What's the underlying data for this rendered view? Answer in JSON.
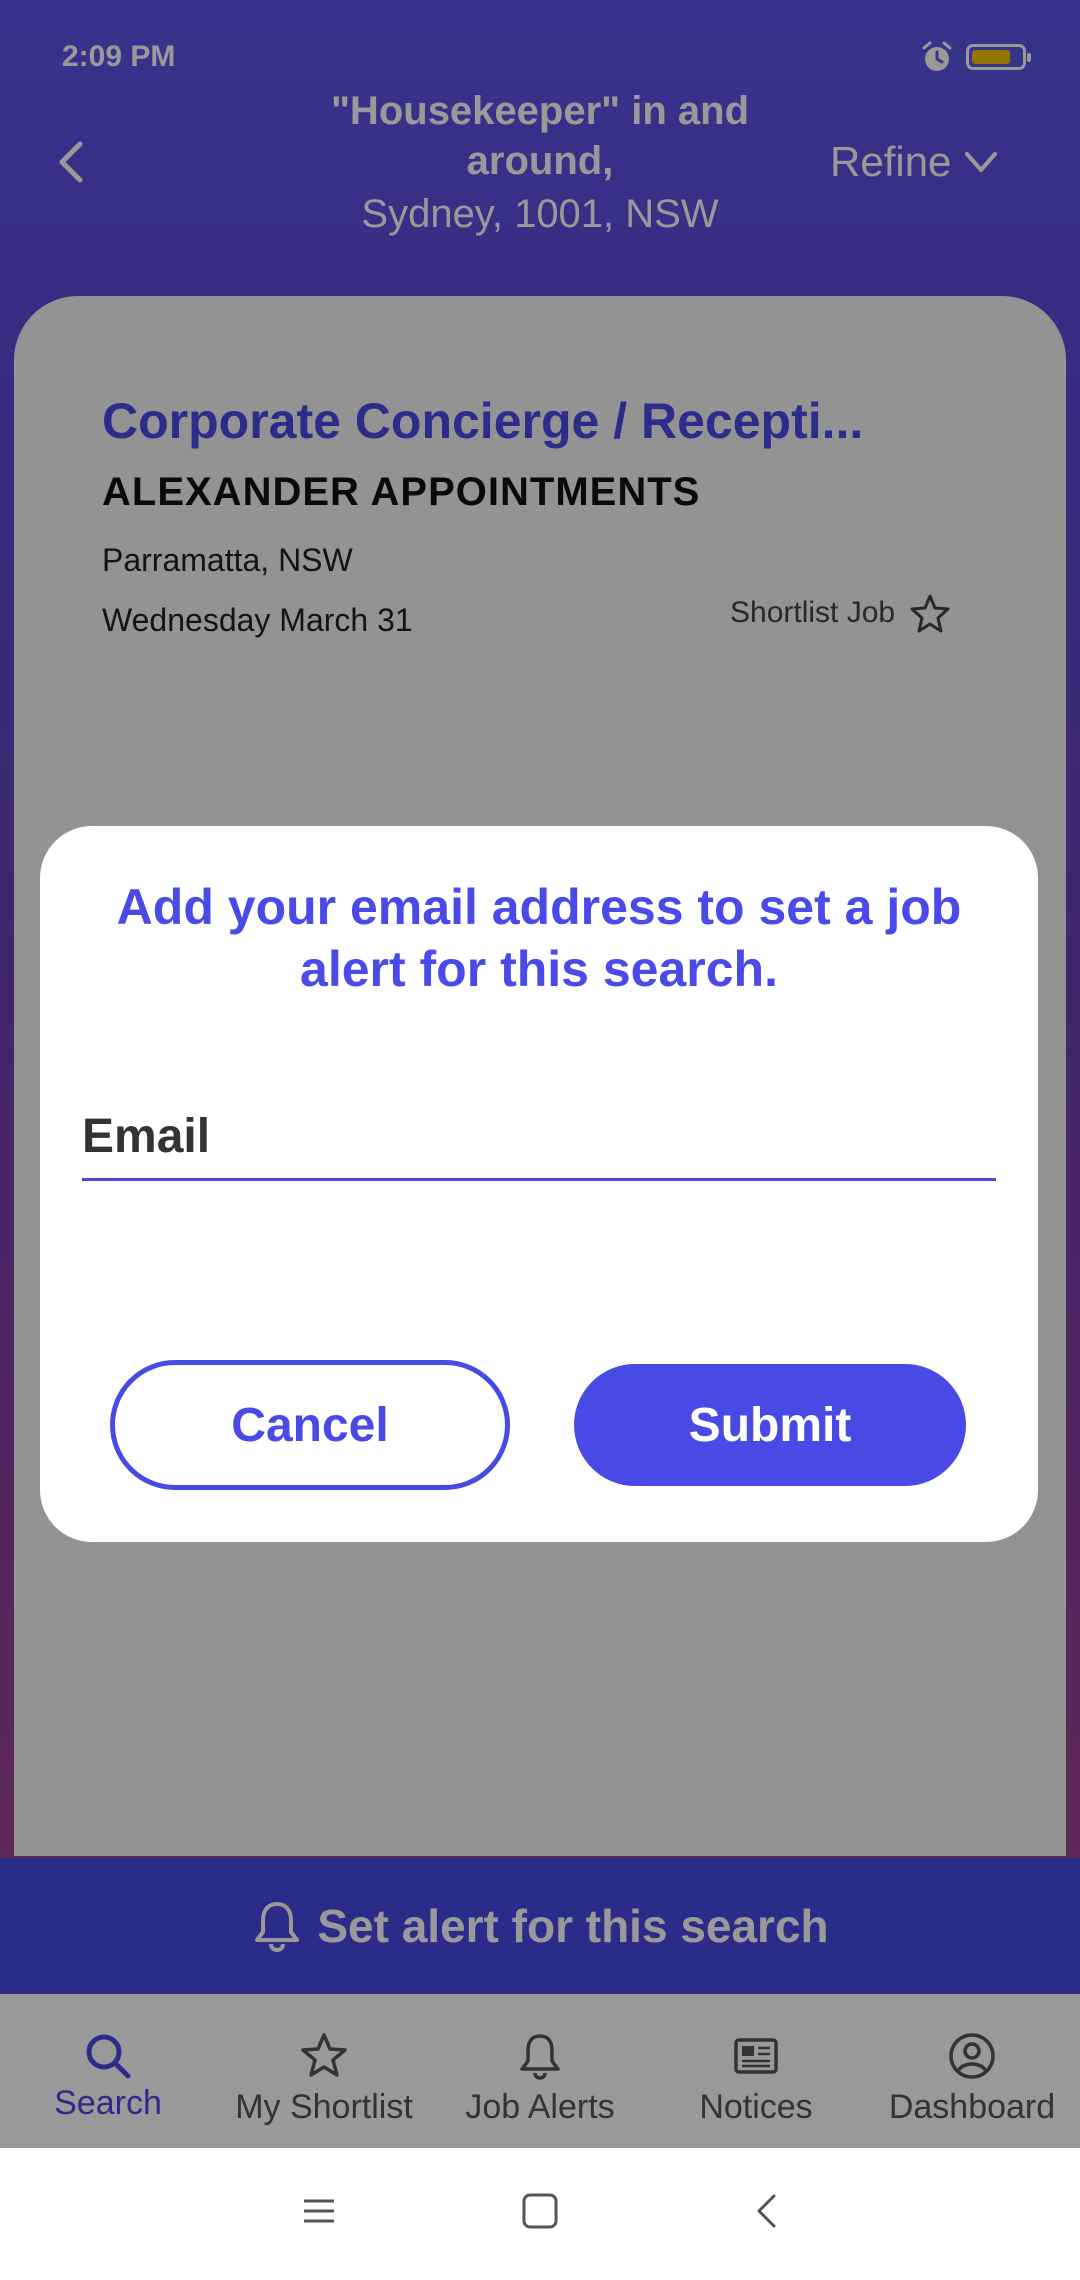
{
  "status_bar": {
    "time": "2:09 PM"
  },
  "header": {
    "title": "\"Housekeeper\" in and around,",
    "location": "Sydney, 1001, NSW",
    "refine_label": "Refine"
  },
  "job": {
    "title": "Corporate Concierge / Recepti...",
    "company": "ALEXANDER APPOINTMENTS",
    "location": "Parramatta, NSW",
    "date": "Wednesday March 31",
    "shortlist_label": "Shortlist Job"
  },
  "alert_bar": {
    "label": "Set alert for this search"
  },
  "tabs": [
    {
      "label": "Search",
      "icon": "search-icon",
      "active": true
    },
    {
      "label": "My Shortlist",
      "icon": "star-icon",
      "active": false
    },
    {
      "label": "Job Alerts",
      "icon": "bell-icon",
      "active": false
    },
    {
      "label": "Notices",
      "icon": "newspaper-icon",
      "active": false
    },
    {
      "label": "Dashboard",
      "icon": "user-icon",
      "active": false
    }
  ],
  "modal": {
    "title": "Add your email address to set a job alert for this search.",
    "email_placeholder": "Email",
    "email_value": "",
    "cancel_label": "Cancel",
    "submit_label": "Submit"
  },
  "colors": {
    "accent": "#4949e6",
    "title_blue": "#4a4ae8",
    "battery": "#f5c200"
  }
}
